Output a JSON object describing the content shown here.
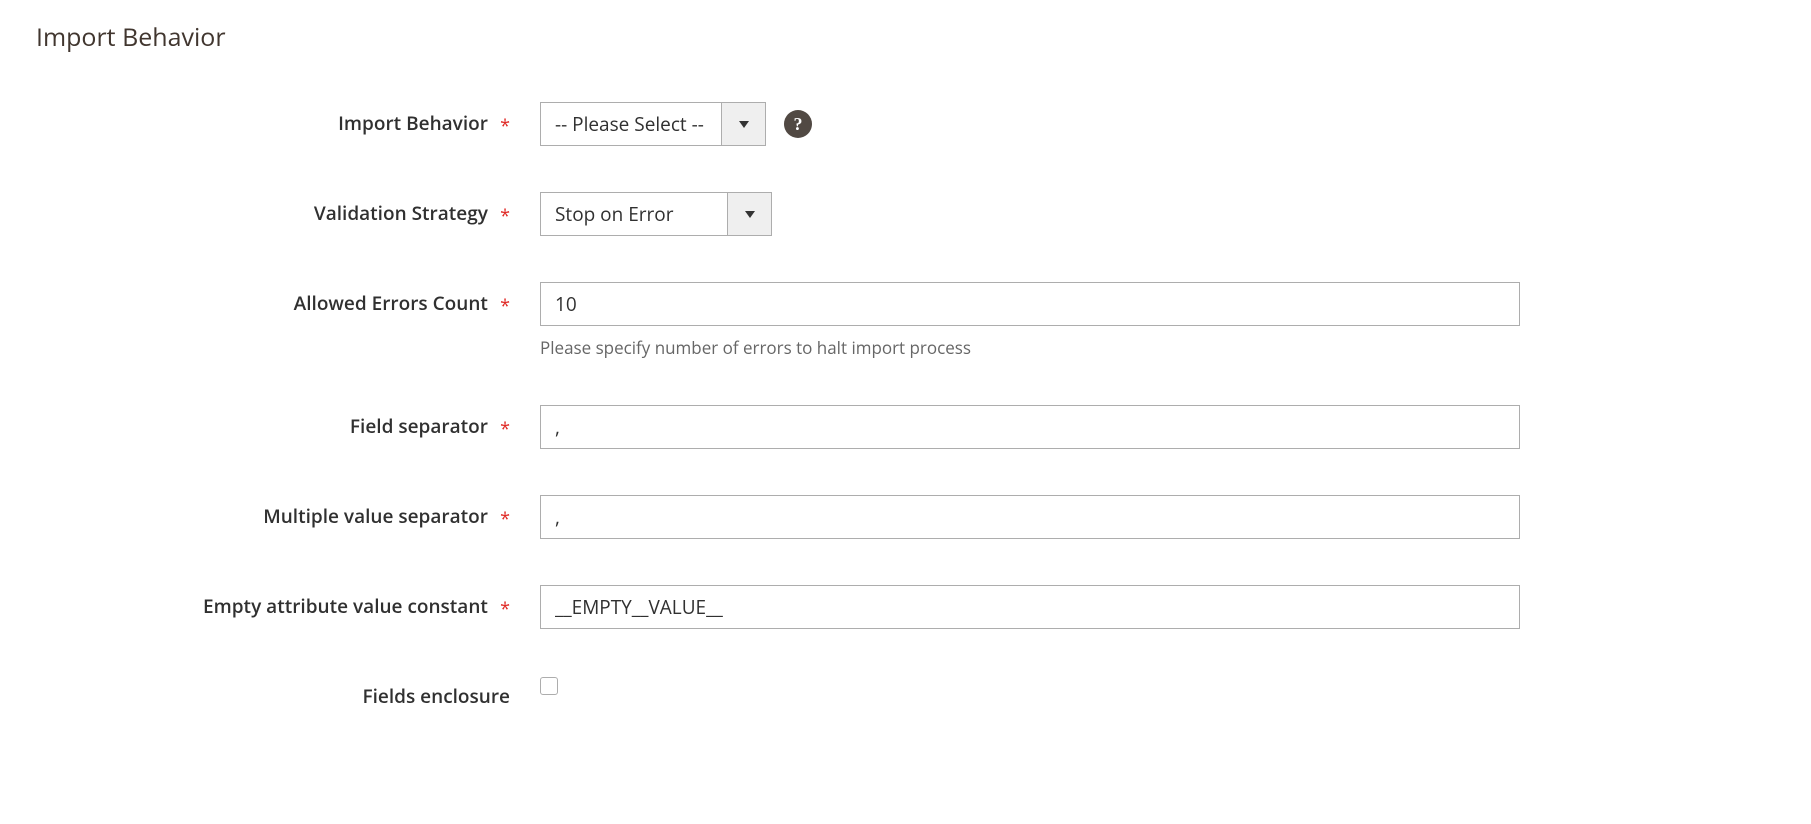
{
  "section": {
    "title": "Import Behavior"
  },
  "fields": {
    "import_behavior": {
      "label": "Import Behavior",
      "value": "-- Please Select --",
      "help_glyph": "?"
    },
    "validation_strategy": {
      "label": "Validation Strategy",
      "value": "Stop on Error"
    },
    "allowed_errors": {
      "label": "Allowed Errors Count",
      "value": "10",
      "note": "Please specify number of errors to halt import process"
    },
    "field_separator": {
      "label": "Field separator",
      "value": ","
    },
    "multiple_value_separator": {
      "label": "Multiple value separator",
      "value": ","
    },
    "empty_attribute_constant": {
      "label": "Empty attribute value constant",
      "value": "__EMPTY__VALUE__"
    },
    "fields_enclosure": {
      "label": "Fields enclosure",
      "checked": false
    }
  }
}
